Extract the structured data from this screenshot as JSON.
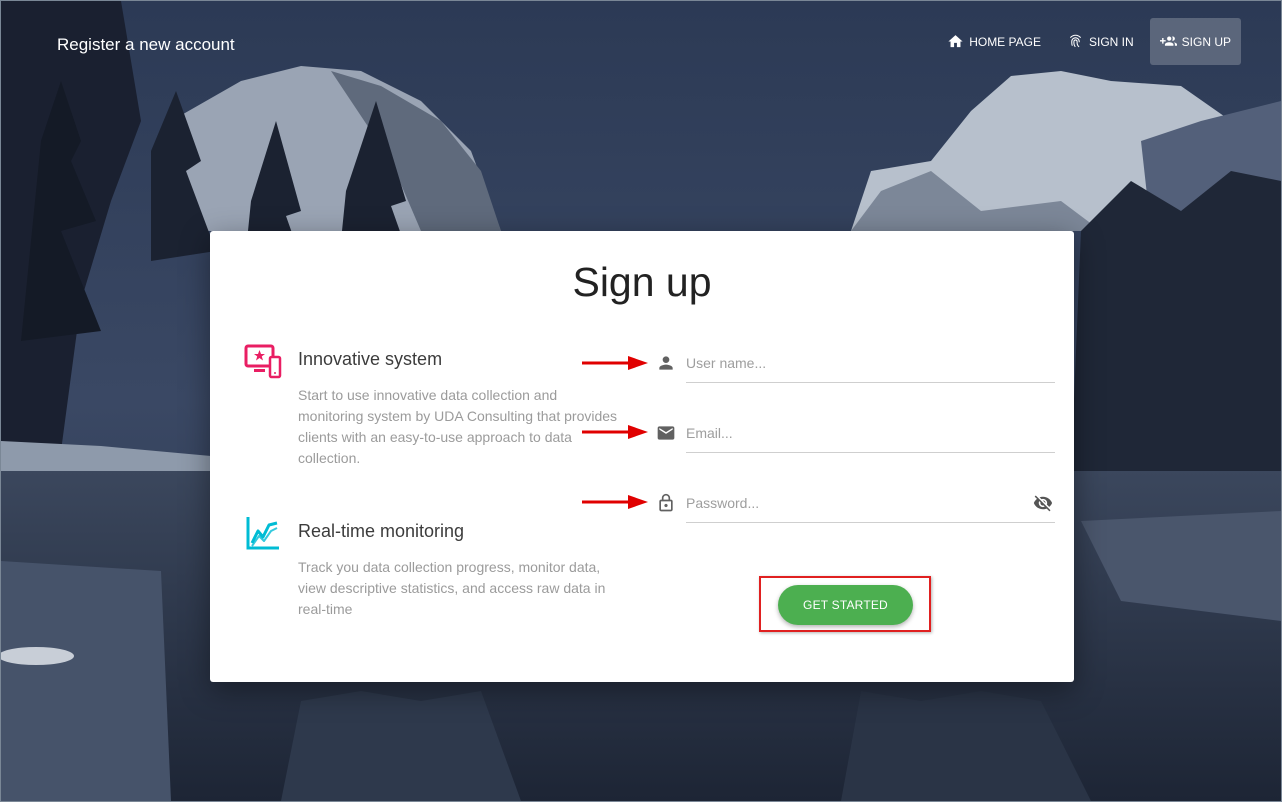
{
  "header": {
    "brand": "Register a new account",
    "nav": [
      {
        "label": "HOME PAGE",
        "icon": "home-icon"
      },
      {
        "label": "SIGN IN",
        "icon": "fingerprint-icon"
      },
      {
        "label": "SIGN UP",
        "icon": "group-add-icon",
        "active": true
      }
    ]
  },
  "card": {
    "title": "Sign up",
    "features": [
      {
        "title": "Innovative system",
        "text": "Start to use innovative data collection and monitoring system by UDA Consulting that provides clients with an easy-to-use approach to data collection.",
        "icon": "devices-icon",
        "color": "#e91e63"
      },
      {
        "title": "Real-time monitoring",
        "text": "Track you data collection progress, monitor data, view descriptive statistics, and access raw data in real-time",
        "icon": "timeline-chart-icon",
        "color": "#00bcd4"
      }
    ],
    "form": {
      "username_placeholder": "User name...",
      "email_placeholder": "Email...",
      "password_placeholder": "Password...",
      "submit_label": "GET STARTED"
    }
  },
  "colors": {
    "accent_green": "#4caf50",
    "annotation_red": "#e02020"
  }
}
